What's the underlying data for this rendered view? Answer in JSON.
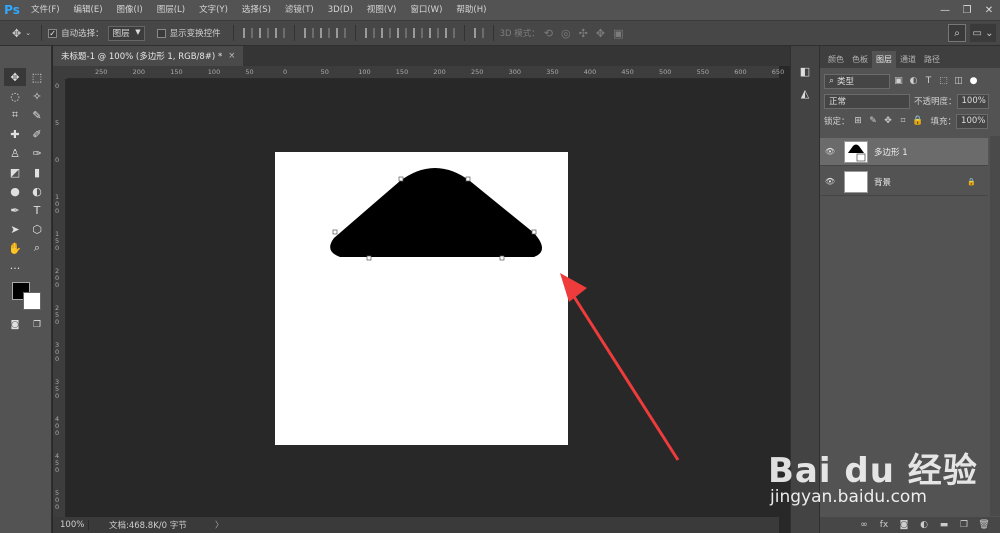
{
  "app": {
    "logo": "Ps"
  },
  "menu": [
    "文件(F)",
    "编辑(E)",
    "图像(I)",
    "图层(L)",
    "文字(Y)",
    "选择(S)",
    "滤镜(T)",
    "3D(D)",
    "视图(V)",
    "窗口(W)",
    "帮助(H)"
  ],
  "window_controls": {
    "minimize": "—",
    "restore": "❐",
    "close": "✕"
  },
  "options": {
    "auto_select_label": "自动选择：",
    "auto_select_value": "图层",
    "show_transform_label": "显示变换控件",
    "mode_3d_label": "3D 模式："
  },
  "document": {
    "tab_title": "未标题-1 @ 100% (多边形 1, RGB/8#) *",
    "close": "×"
  },
  "ruler_h": [
    "250",
    "200",
    "150",
    "100",
    "50",
    "0",
    "50",
    "100",
    "150",
    "200",
    "250",
    "300",
    "350",
    "400",
    "450",
    "500",
    "550",
    "600",
    "650"
  ],
  "ruler_v": [
    "0",
    "5",
    "0",
    "1 0 0",
    "1 5 0",
    "2 0 0",
    "2 5 0",
    "3 0 0",
    "3 5 0",
    "4 0 0",
    "4 5 0",
    "5 0 0"
  ],
  "status": {
    "zoom": "100%",
    "doc_info": "文档:468.8K/0 字节",
    "arrow": "〉"
  },
  "panel": {
    "tabs": [
      "颜色",
      "色板",
      "图层",
      "通道",
      "路径"
    ],
    "filter_kind": "类型",
    "blend_mode": "正常",
    "opacity_label": "不透明度：",
    "opacity_value": "100%",
    "lock_label": "锁定：",
    "fill_label": "填充：",
    "fill_value": "100%",
    "layers": [
      {
        "name": "多边形 1",
        "selected": true
      },
      {
        "name": "背景",
        "selected": false
      }
    ],
    "footer_fx": "fx"
  },
  "watermark": {
    "brand": "Bai du 经验",
    "url": "jingyan.baidu.com"
  },
  "colors": {
    "accent": "#31a8ff",
    "arrow": "#ee3b3b",
    "shape": "#000000"
  }
}
